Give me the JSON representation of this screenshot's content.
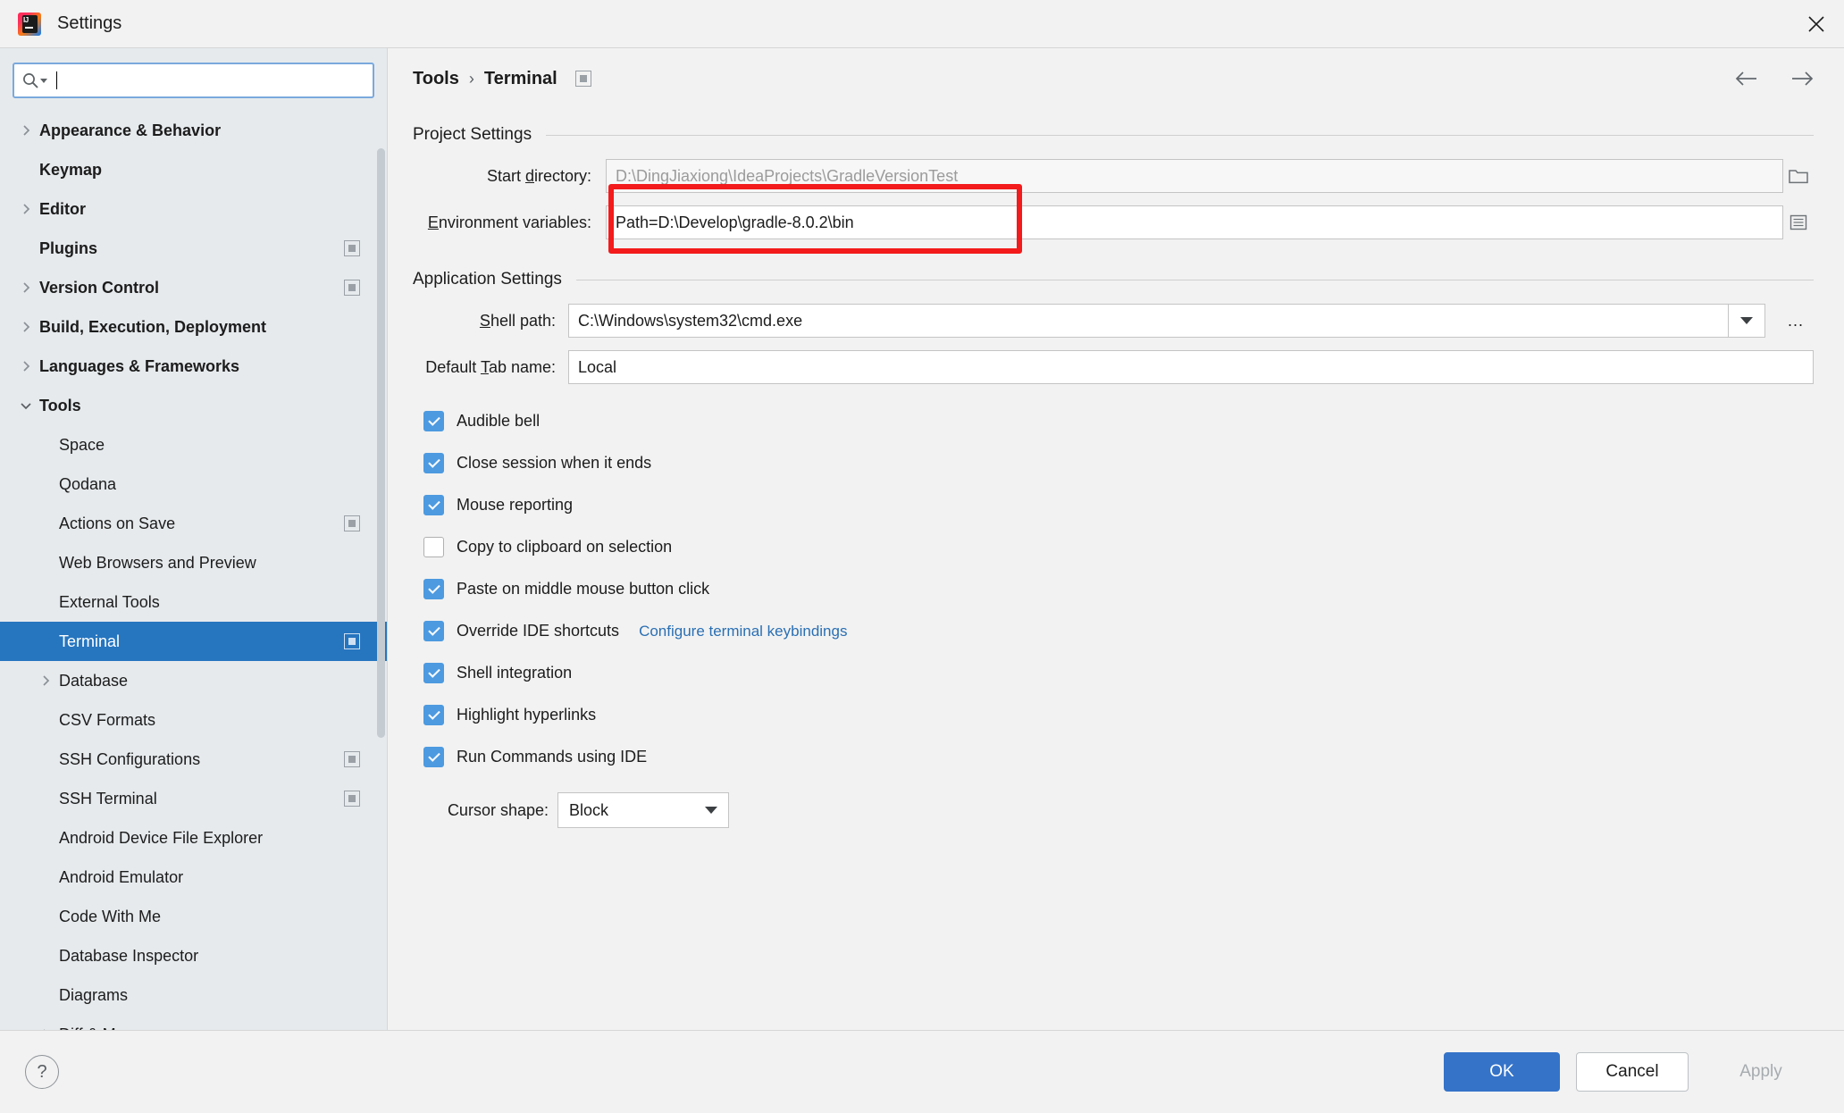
{
  "window": {
    "title": "Settings",
    "logo_alt": "intellij-idea-logo",
    "close_label": "×"
  },
  "search": {
    "value": "",
    "placeholder": ""
  },
  "sidebar": {
    "items": [
      {
        "label": "Appearance & Behavior",
        "level": 0,
        "arrow": "right",
        "bold": true,
        "selected": false,
        "badge": false
      },
      {
        "label": "Keymap",
        "level": 0,
        "arrow": "none",
        "bold": true,
        "selected": false,
        "badge": false
      },
      {
        "label": "Editor",
        "level": 0,
        "arrow": "right",
        "bold": true,
        "selected": false,
        "badge": false
      },
      {
        "label": "Plugins",
        "level": 0,
        "arrow": "none",
        "bold": true,
        "selected": false,
        "badge": true
      },
      {
        "label": "Version Control",
        "level": 0,
        "arrow": "right",
        "bold": true,
        "selected": false,
        "badge": true
      },
      {
        "label": "Build, Execution, Deployment",
        "level": 0,
        "arrow": "right",
        "bold": true,
        "selected": false,
        "badge": false
      },
      {
        "label": "Languages & Frameworks",
        "level": 0,
        "arrow": "right",
        "bold": true,
        "selected": false,
        "badge": false
      },
      {
        "label": "Tools",
        "level": 0,
        "arrow": "down",
        "bold": true,
        "selected": false,
        "badge": false
      },
      {
        "label": "Space",
        "level": 1,
        "arrow": "none",
        "bold": false,
        "selected": false,
        "badge": false
      },
      {
        "label": "Qodana",
        "level": 1,
        "arrow": "none",
        "bold": false,
        "selected": false,
        "badge": false
      },
      {
        "label": "Actions on Save",
        "level": 1,
        "arrow": "none",
        "bold": false,
        "selected": false,
        "badge": true
      },
      {
        "label": "Web Browsers and Preview",
        "level": 1,
        "arrow": "none",
        "bold": false,
        "selected": false,
        "badge": false
      },
      {
        "label": "External Tools",
        "level": 1,
        "arrow": "none",
        "bold": false,
        "selected": false,
        "badge": false
      },
      {
        "label": "Terminal",
        "level": 1,
        "arrow": "none",
        "bold": false,
        "selected": true,
        "badge": true
      },
      {
        "label": "Database",
        "level": 1,
        "arrow": "right",
        "bold": false,
        "selected": false,
        "badge": false
      },
      {
        "label": "CSV Formats",
        "level": 1,
        "arrow": "none",
        "bold": false,
        "selected": false,
        "badge": false
      },
      {
        "label": "SSH Configurations",
        "level": 1,
        "arrow": "none",
        "bold": false,
        "selected": false,
        "badge": true
      },
      {
        "label": "SSH Terminal",
        "level": 1,
        "arrow": "none",
        "bold": false,
        "selected": false,
        "badge": true
      },
      {
        "label": "Android Device File Explorer",
        "level": 1,
        "arrow": "none",
        "bold": false,
        "selected": false,
        "badge": false
      },
      {
        "label": "Android Emulator",
        "level": 1,
        "arrow": "none",
        "bold": false,
        "selected": false,
        "badge": false
      },
      {
        "label": "Code With Me",
        "level": 1,
        "arrow": "none",
        "bold": false,
        "selected": false,
        "badge": false
      },
      {
        "label": "Database Inspector",
        "level": 1,
        "arrow": "none",
        "bold": false,
        "selected": false,
        "badge": false
      },
      {
        "label": "Diagrams",
        "level": 1,
        "arrow": "none",
        "bold": false,
        "selected": false,
        "badge": false
      },
      {
        "label": "Diff & Merge",
        "level": 1,
        "arrow": "right",
        "bold": false,
        "selected": false,
        "badge": false
      }
    ]
  },
  "breadcrumb": {
    "root": "Tools",
    "separator": "›",
    "current": "Terminal"
  },
  "project_settings": {
    "group_title": "Project Settings",
    "start_directory": {
      "label_pre": "Start ",
      "label_mnemonic": "d",
      "label_post": "irectory:",
      "value": "D:\\DingJiaxiong\\IdeaProjects\\GradleVersionTest",
      "browse_icon": "folder-icon"
    },
    "environment_variables": {
      "label_pre": "",
      "label_mnemonic": "E",
      "label_post": "nvironment variables:",
      "value": "Path=D:\\Develop\\gradle-8.0.2\\bin",
      "expand_icon": "list-editor-icon",
      "highlight_color": "#f31b1b"
    }
  },
  "application_settings": {
    "group_title": "Application Settings",
    "shell_path": {
      "label_pre": "S",
      "label_mnemonic": "h",
      "label_post": "ell path:",
      "label_full": "Shell path:",
      "value": "C:\\Windows\\system32\\cmd.exe",
      "more_button": "..."
    },
    "default_tab_name": {
      "label_full": "Default Tab name:",
      "value": "Local"
    },
    "checkboxes": [
      {
        "label": "Audible bell",
        "checked": true
      },
      {
        "label": "Close session when it ends",
        "checked": true
      },
      {
        "label": "Mouse reporting",
        "checked": true
      },
      {
        "label": "Copy to clipboard on selection",
        "checked": false
      },
      {
        "label": "Paste on middle mouse button click",
        "checked": true
      },
      {
        "label": "Override IDE shortcuts",
        "checked": true,
        "link": "Configure terminal keybindings"
      },
      {
        "label": "Shell integration",
        "checked": true
      },
      {
        "label": "Highlight hyperlinks",
        "checked": true
      },
      {
        "label": "Run Commands using IDE",
        "checked": true
      }
    ],
    "cursor_shape": {
      "label": "Cursor shape:",
      "value": "Block"
    }
  },
  "footer": {
    "help_label": "?",
    "ok_label": "OK",
    "cancel_label": "Cancel",
    "apply_label": "Apply"
  },
  "colors": {
    "selection_blue": "#2675bf",
    "primary_button": "#3573c9",
    "checkbox_blue": "#4d9ae0",
    "link_blue": "#2a6fb3",
    "highlight_red": "#f31b1b",
    "sidebar_bg": "#e6eaed",
    "panel_bg": "#f2f2f2"
  }
}
